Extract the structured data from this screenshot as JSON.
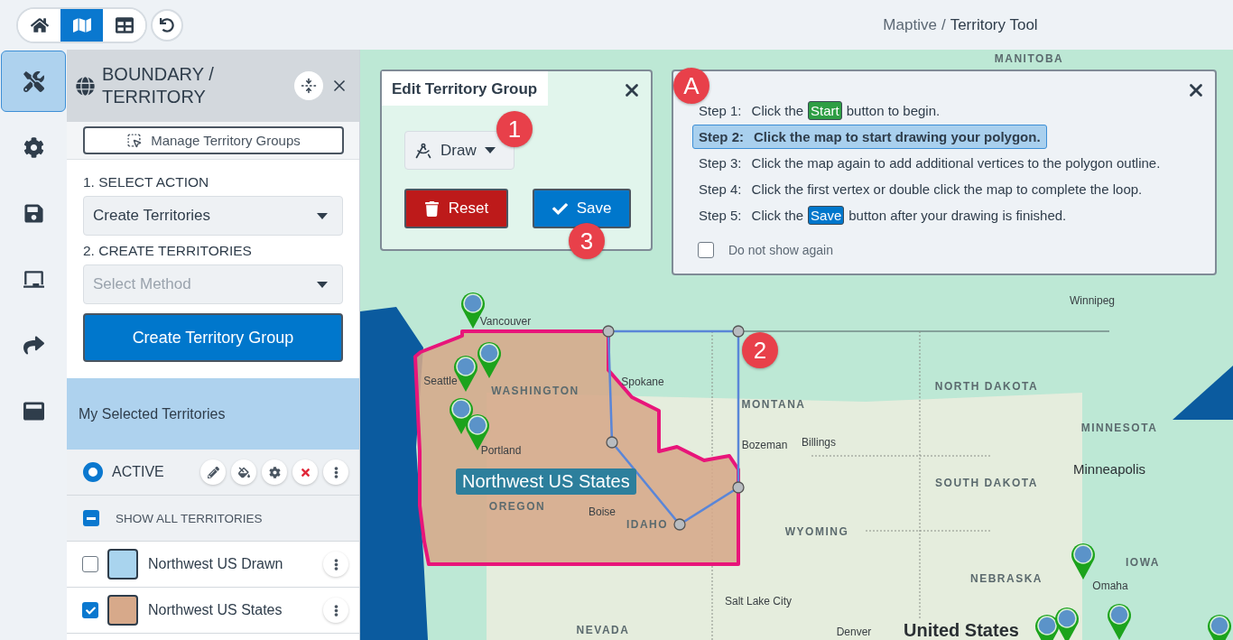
{
  "top_bar": {
    "nav": [
      {
        "selected": false
      },
      {
        "selected": true
      },
      {
        "selected": false
      }
    ],
    "breadcrumb": {
      "app": "Maptive",
      "separator": "/",
      "page": "Territory Tool"
    }
  },
  "rail": [
    {
      "selected": true
    },
    {
      "selected": false
    },
    {
      "selected": false
    },
    {
      "selected": false
    },
    {
      "selected": false
    },
    {
      "selected": false
    }
  ],
  "panel": {
    "title": "BOUNDARY / TERRITORY",
    "manage_button": "Manage Territory Groups",
    "action_label": "1. SELECT ACTION",
    "action_select": {
      "value": "Create Territories"
    },
    "method_label": "2. CREATE TERRITORIES",
    "method_select": {
      "placeholder": "Select Method"
    },
    "create_button": "Create Territory Group",
    "selected_heading": "My Selected Territories",
    "active_radio": {
      "label": "ACTIVE",
      "selected": true
    },
    "show_all": {
      "label": "SHOW ALL TERRITORIES",
      "checked": true,
      "indeterminate": true
    },
    "territories": [
      {
        "name": "Northwest US Drawn",
        "checked": false,
        "color": "#a9d4ee"
      },
      {
        "name": "Northwest US States",
        "checked": true,
        "color": "#d7a98a"
      }
    ]
  },
  "edit_panel": {
    "title": "Edit Territory Group",
    "draw_button": "Draw",
    "reset_button": "Reset",
    "save_button": "Save"
  },
  "steps_panel": {
    "steps": [
      {
        "label": "Step 1:",
        "parts": [
          {
            "text": "Click the"
          },
          {
            "chip": "Start",
            "color": "#2e9e44"
          },
          {
            "text": "button to begin."
          }
        ],
        "selected": false
      },
      {
        "label": "Step 2:",
        "parts": [
          {
            "text": "Click the map to start drawing your polygon."
          }
        ],
        "selected": true
      },
      {
        "label": "Step 3:",
        "parts": [
          {
            "text": "Click the map again to add additional vertices to the polygon outline."
          }
        ],
        "selected": false
      },
      {
        "label": "Step 4:",
        "parts": [
          {
            "text": "Click the first vertex or double click the map to complete the loop."
          }
        ],
        "selected": false
      },
      {
        "label": "Step 5:",
        "parts": [
          {
            "text": "Click the"
          },
          {
            "chip": "Save",
            "color": "#0077cc"
          },
          {
            "text": "button after your drawing is finished."
          }
        ],
        "selected": false
      }
    ],
    "do_not_show": {
      "label": "Do not show again",
      "checked": false
    }
  },
  "map": {
    "territory_label": "Northwest US States",
    "labels": [
      {
        "text": "MANITOBA",
        "kind": "state"
      },
      {
        "text": "Winnipeg",
        "kind": "city"
      },
      {
        "text": "Vancouver",
        "kind": "city"
      },
      {
        "text": "Seattle",
        "kind": "city"
      },
      {
        "text": "Spokane",
        "kind": "city"
      },
      {
        "text": "WASHINGTON",
        "kind": "state"
      },
      {
        "text": "Portland",
        "kind": "city"
      },
      {
        "text": "OREGON",
        "kind": "state"
      },
      {
        "text": "Boise",
        "kind": "city"
      },
      {
        "text": "IDAHO",
        "kind": "state"
      },
      {
        "text": "MONTANA",
        "kind": "state"
      },
      {
        "text": "Bozeman",
        "kind": "city"
      },
      {
        "text": "Billings",
        "kind": "city"
      },
      {
        "text": "NORTH DAKOTA",
        "kind": "state"
      },
      {
        "text": "SOUTH DAKOTA",
        "kind": "state"
      },
      {
        "text": "MINNESOTA",
        "kind": "state"
      },
      {
        "text": "Minneapolis",
        "kind": "bigcity"
      },
      {
        "text": "WYOMING",
        "kind": "state"
      },
      {
        "text": "NEBRASKA",
        "kind": "state"
      },
      {
        "text": "Omaha",
        "kind": "city"
      },
      {
        "text": "IOWA",
        "kind": "state"
      },
      {
        "text": "Salt Lake City",
        "kind": "city"
      },
      {
        "text": "NEVADA",
        "kind": "state"
      },
      {
        "text": "Denver",
        "kind": "city"
      },
      {
        "text": "United States",
        "kind": "country"
      }
    ]
  },
  "callouts": [
    "1",
    "2",
    "3",
    "A"
  ]
}
